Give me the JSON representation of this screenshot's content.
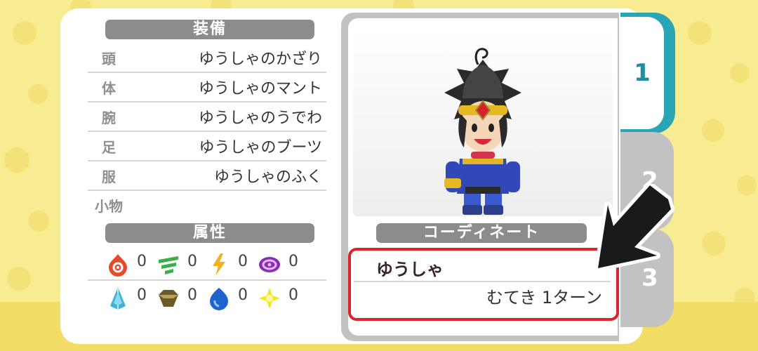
{
  "equipment": {
    "title": "装備",
    "slots": [
      {
        "slot": "頭",
        "item": "ゆうしゃのかざり"
      },
      {
        "slot": "体",
        "item": "ゆうしゃのマント"
      },
      {
        "slot": "腕",
        "item": "ゆうしゃのうでわ"
      },
      {
        "slot": "足",
        "item": "ゆうしゃのブーツ"
      },
      {
        "slot": "服",
        "item": "ゆうしゃのふく"
      },
      {
        "slot": "小物",
        "item": ""
      }
    ]
  },
  "attributes": {
    "title": "属性",
    "row1": [
      {
        "icon": "fire-icon",
        "value": "0"
      },
      {
        "icon": "wind-icon",
        "value": "0"
      },
      {
        "icon": "lightning-icon",
        "value": "0"
      },
      {
        "icon": "dark-swirl-icon",
        "value": "0"
      }
    ],
    "row2": [
      {
        "icon": "ice-icon",
        "value": "0"
      },
      {
        "icon": "earth-icon",
        "value": "0"
      },
      {
        "icon": "water-icon",
        "value": "0"
      },
      {
        "icon": "light-icon",
        "value": "0"
      }
    ]
  },
  "coordinate": {
    "title": "コーディネート",
    "name": "ゆうしゃ",
    "effect": "むてき 1ターン"
  },
  "tabs": [
    {
      "label": "1",
      "active": true
    },
    {
      "label": "2",
      "active": false
    },
    {
      "label": "3",
      "active": false
    }
  ],
  "colors": {
    "background": "#f8ec92",
    "tab_active": "#2aa5b5",
    "tab_inactive": "#c2c2c2",
    "highlight_border": "#d9252b",
    "header_gray": "#8c8c8c"
  }
}
